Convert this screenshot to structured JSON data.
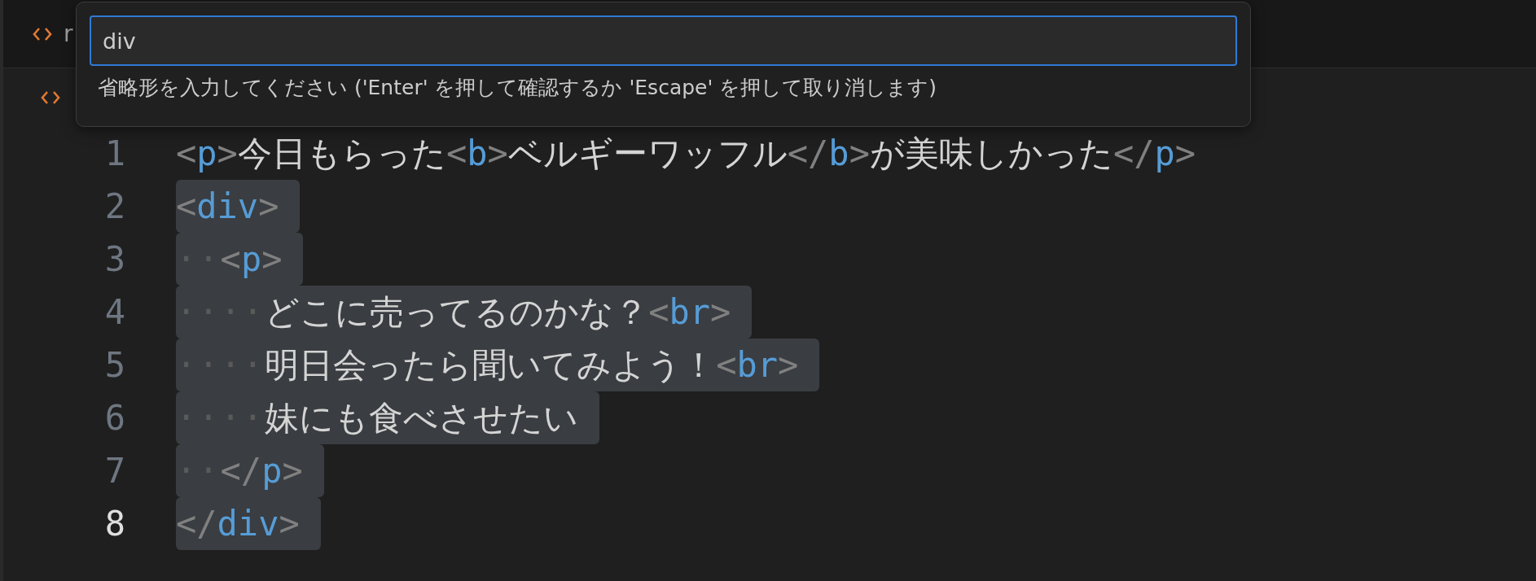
{
  "tab": {
    "label": "r"
  },
  "quick_input": {
    "value": "div",
    "hint": "省略形を入力してください ('Enter' を押して確認するか 'Escape' を押して取り消します)"
  },
  "lines": [
    {
      "number": "1",
      "selected": false,
      "current": false,
      "tokens": [
        {
          "kind": "punct",
          "text": "<"
        },
        {
          "kind": "tag",
          "text": "p"
        },
        {
          "kind": "punct",
          "text": ">"
        },
        {
          "kind": "text",
          "text": "今日もらった"
        },
        {
          "kind": "punct",
          "text": "<"
        },
        {
          "kind": "tag",
          "text": "b"
        },
        {
          "kind": "punct",
          "text": ">"
        },
        {
          "kind": "text",
          "text": "ベルギーワッフル"
        },
        {
          "kind": "punct",
          "text": "</"
        },
        {
          "kind": "tag",
          "text": "b"
        },
        {
          "kind": "punct",
          "text": ">"
        },
        {
          "kind": "text",
          "text": "が美味しかった"
        },
        {
          "kind": "punct",
          "text": "</"
        },
        {
          "kind": "tag",
          "text": "p"
        },
        {
          "kind": "punct",
          "text": ">"
        }
      ]
    },
    {
      "number": "2",
      "selected": true,
      "current": false,
      "tokens": [
        {
          "kind": "punct",
          "text": "<"
        },
        {
          "kind": "tag",
          "text": "div"
        },
        {
          "kind": "punct",
          "text": ">"
        }
      ]
    },
    {
      "number": "3",
      "selected": true,
      "current": false,
      "tokens": [
        {
          "kind": "space",
          "text": "··"
        },
        {
          "kind": "punct",
          "text": "<"
        },
        {
          "kind": "tag",
          "text": "p"
        },
        {
          "kind": "punct",
          "text": ">"
        }
      ]
    },
    {
      "number": "4",
      "selected": true,
      "current": false,
      "tokens": [
        {
          "kind": "space",
          "text": "····"
        },
        {
          "kind": "text",
          "text": "どこに売ってるのかな？"
        },
        {
          "kind": "punct",
          "text": "<"
        },
        {
          "kind": "tag",
          "text": "br"
        },
        {
          "kind": "punct",
          "text": ">"
        }
      ]
    },
    {
      "number": "5",
      "selected": true,
      "current": false,
      "tokens": [
        {
          "kind": "space",
          "text": "····"
        },
        {
          "kind": "text",
          "text": "明日会ったら聞いてみよう！"
        },
        {
          "kind": "punct",
          "text": "<"
        },
        {
          "kind": "tag",
          "text": "br"
        },
        {
          "kind": "punct",
          "text": ">"
        }
      ]
    },
    {
      "number": "6",
      "selected": true,
      "current": false,
      "tokens": [
        {
          "kind": "space",
          "text": "····"
        },
        {
          "kind": "text",
          "text": "妹にも食べさせたい"
        }
      ]
    },
    {
      "number": "7",
      "selected": true,
      "current": false,
      "tokens": [
        {
          "kind": "space",
          "text": "··"
        },
        {
          "kind": "punct",
          "text": "</"
        },
        {
          "kind": "tag",
          "text": "p"
        },
        {
          "kind": "punct",
          "text": ">"
        }
      ]
    },
    {
      "number": "8",
      "selected": true,
      "current": true,
      "tokens": [
        {
          "kind": "punct",
          "text": "</"
        },
        {
          "kind": "tag",
          "text": "div"
        },
        {
          "kind": "punct",
          "text": ">"
        }
      ]
    }
  ]
}
